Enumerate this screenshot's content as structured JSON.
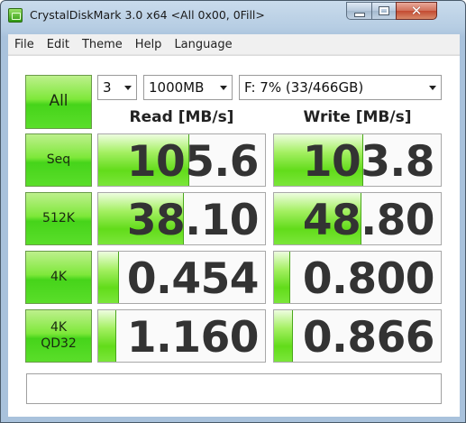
{
  "window": {
    "title": "CrystalDiskMark 3.0 x64 <All 0x00, 0Fill>",
    "close_glyph": "✕"
  },
  "menu": [
    "File",
    "Edit",
    "Theme",
    "Help",
    "Language"
  ],
  "controls": {
    "all_label": "All",
    "test_count": "3",
    "test_size": "1000MB",
    "drive": "F: 7% (33/466GB)"
  },
  "headers": {
    "read": "Read [MB/s]",
    "write": "Write [MB/s]"
  },
  "rows": [
    {
      "label": "Seq",
      "read": "105.6",
      "write": "103.8",
      "read_fill": 0.54,
      "write_fill": 0.53
    },
    {
      "label": "512K",
      "read": "38.10",
      "write": "48.80",
      "read_fill": 0.51,
      "write_fill": 0.52
    },
    {
      "label": "4K",
      "read": "0.454",
      "write": "0.800",
      "read_fill": 0.12,
      "write_fill": 0.09
    },
    {
      "label": "4K\nQD32",
      "read": "1.160",
      "write": "0.866",
      "read_fill": 0.1,
      "write_fill": 0.11
    }
  ],
  "comment": "",
  "colors": {
    "accent_green": "#46d41a",
    "bar_green": "#62dc1a"
  }
}
